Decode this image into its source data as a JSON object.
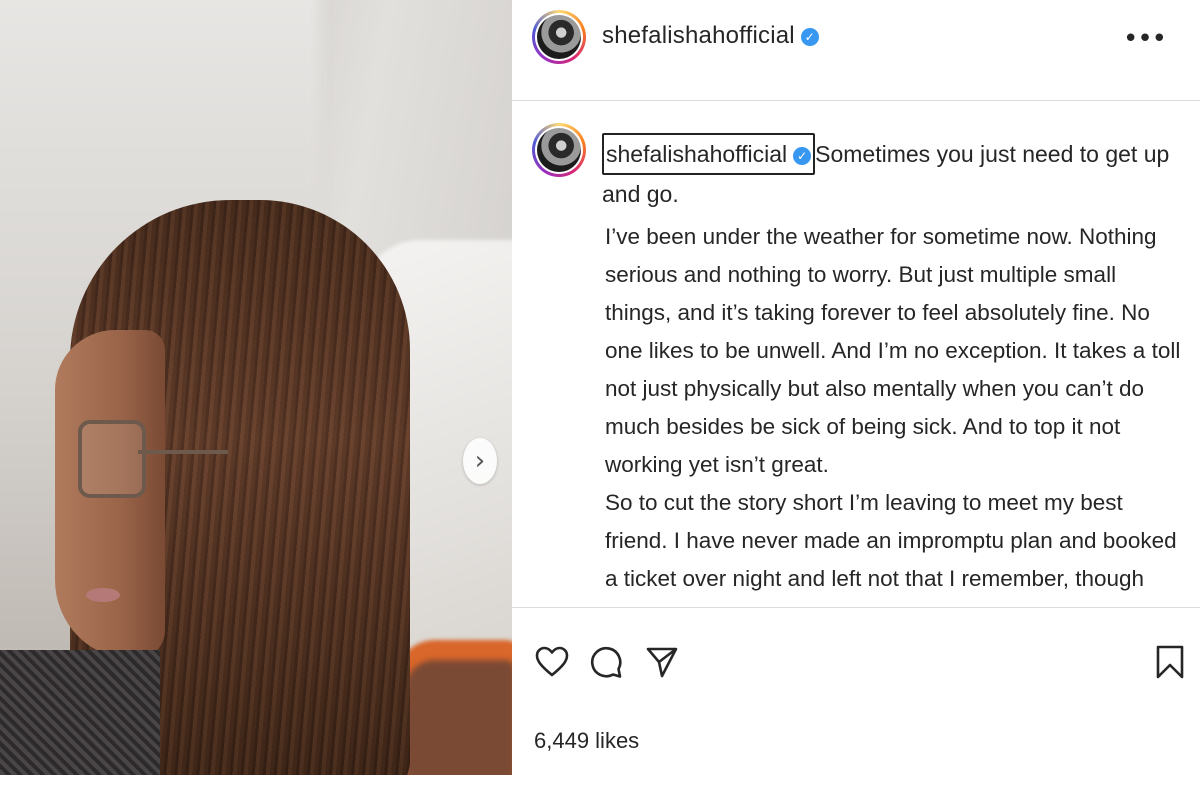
{
  "post": {
    "username": "shefalishahofficial",
    "verified_icon": "verified-badge-icon",
    "more_label": "•••",
    "caption_first_line": "Sometimes you just need to get up and go.",
    "caption_paragraphs": [
      "I’ve been under the weather for sometime now. Nothing serious and nothing to worry. But just multiple small things, and it’s taking forever to feel absolutely fine. No one likes to be unwell. And I’m no exception. It takes a toll not just physically but also mentally when you can’t do much besides be sick of being sick. And to top it not working yet isn’t great.",
      "So to cut the story short I’m leaving to meet my best friend. I have never made an impromptu plan and booked a ticket over night and left not that I remember, though I’ve always wanted to. But well there’s always a first and I’m hoping there will be many"
    ],
    "likes": "6,449 likes",
    "next_label": "›"
  },
  "colors": {
    "accent_blue": "#3897f0",
    "divider": "#dbdbdb",
    "text": "#262626"
  },
  "icons": [
    "heart-icon",
    "comment-icon",
    "share-icon",
    "bookmark-icon",
    "chevron-right-icon",
    "more-icon"
  ]
}
